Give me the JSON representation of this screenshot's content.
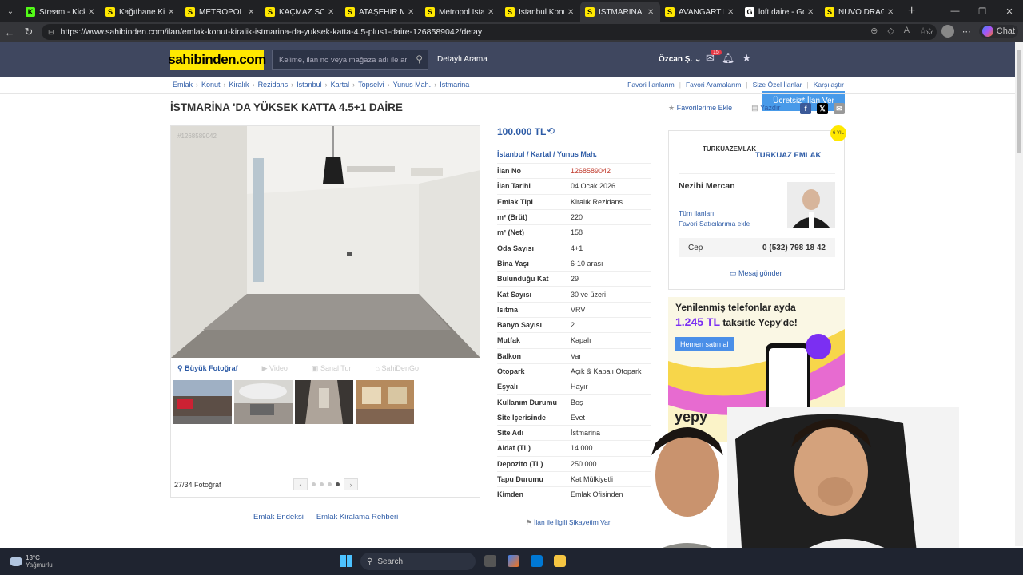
{
  "browser": {
    "tabs": [
      {
        "title": "Stream - Kick Das",
        "icon_color": "#53fc18",
        "icon_letter": "K",
        "active": false
      },
      {
        "title": "Kağıthane Kiralık",
        "icon_color": "#ffe800",
        "icon_letter": "S",
        "active": false
      },
      {
        "title": "METROPOL İSTAN",
        "icon_color": "#ffe800",
        "icon_letter": "S",
        "active": false
      },
      {
        "title": "KAÇMAZ SON FI",
        "icon_color": "#ffe800",
        "icon_letter": "S",
        "active": false
      },
      {
        "title": "ATAŞEHİR METRO",
        "icon_color": "#ffe800",
        "icon_letter": "S",
        "active": false
      },
      {
        "title": "Metropol İstanbu",
        "icon_color": "#ffe800",
        "icon_letter": "S",
        "active": false
      },
      {
        "title": "İstanbul Konut Fi",
        "icon_color": "#ffe800",
        "icon_letter": "S",
        "active": false
      },
      {
        "title": "İSTMARİNA 'DA Y",
        "icon_color": "#ffe800",
        "icon_letter": "S",
        "active": true
      },
      {
        "title": "AVANGART İSTAN",
        "icon_color": "#ffe800",
        "icon_letter": "S",
        "active": false
      },
      {
        "title": "loft daire - Googl",
        "icon_color": "#ffffff",
        "icon_letter": "G",
        "active": false
      },
      {
        "title": "NUVO DRAGOS S",
        "icon_color": "#ffe800",
        "icon_letter": "S",
        "active": false
      }
    ],
    "url": "https://www.sahibinden.com/ilan/emlak-konut-kiralik-istmarina-da-yuksek-katta-4.5-plus1-daire-1268589042/detay",
    "chat_label": "Chat"
  },
  "header": {
    "logo": "sahibinden.com",
    "search_placeholder": "Kelime, ilan no veya mağaza adı ile ara",
    "detailed_search": "Detaylı Arama",
    "user": "Özcan Ş.",
    "message_count": "15",
    "post_button": "Ücretsiz* İlan Ver"
  },
  "breadcrumb": [
    "Emlak",
    "Konut",
    "Kiralık",
    "Rezidans",
    "İstanbul",
    "Kartal",
    "Topselvi",
    "Yunus Mah.",
    "İstmarina"
  ],
  "quicklinks": [
    "Favori İlanlarım",
    "Favori Aramalarım",
    "Size Özel İlanlar",
    "Karşılaştır"
  ],
  "listing": {
    "title": "İSTMARİNA 'DA YÜKSEK KATTA 4.5+1 DAİRE",
    "add_favorite": "Favorilerime Ekle",
    "print": "Yazdır",
    "price": "100.000 TL",
    "location": [
      "İstanbul",
      "Kartal",
      "Yunus Mah."
    ],
    "photo_id": "#1268589042",
    "attributes": [
      {
        "k": "İlan No",
        "v": "1268589042",
        "red": true
      },
      {
        "k": "İlan Tarihi",
        "v": "04 Ocak 2026"
      },
      {
        "k": "Emlak Tipi",
        "v": "Kiralık Rezidans"
      },
      {
        "k": "m² (Brüt)",
        "v": "220"
      },
      {
        "k": "m² (Net)",
        "v": "158"
      },
      {
        "k": "Oda Sayısı",
        "v": "4+1"
      },
      {
        "k": "Bina Yaşı",
        "v": "6-10 arası"
      },
      {
        "k": "Bulunduğu Kat",
        "v": "29"
      },
      {
        "k": "Kat Sayısı",
        "v": "30 ve üzeri"
      },
      {
        "k": "Isıtma",
        "v": "VRV"
      },
      {
        "k": "Banyo Sayısı",
        "v": "2"
      },
      {
        "k": "Mutfak",
        "v": "Kapalı"
      },
      {
        "k": "Balkon",
        "v": "Var"
      },
      {
        "k": "Otopark",
        "v": "Açık & Kapalı Otopark"
      },
      {
        "k": "Eşyalı",
        "v": "Hayır"
      },
      {
        "k": "Kullanım Durumu",
        "v": "Boş"
      },
      {
        "k": "Site İçerisinde",
        "v": "Evet"
      },
      {
        "k": "Site Adı",
        "v": "İstmarina"
      },
      {
        "k": "Aidat (TL)",
        "v": "14.000"
      },
      {
        "k": "Depozito (TL)",
        "v": "250.000"
      },
      {
        "k": "Tapu Durumu",
        "v": "Kat Mülkiyetli"
      },
      {
        "k": "Kimden",
        "v": "Emlak Ofisinden"
      }
    ]
  },
  "gallery": {
    "big_photo": "Büyük Fotoğraf",
    "video": "Video",
    "virtual_tour": "Sanal Tur",
    "owner_home": "SahiDenGo",
    "count": "27/34 Fotoğraf",
    "page_dots": 4,
    "active_dot": 3
  },
  "seller": {
    "agency_logo": "TURKUAZEMLAK",
    "agency": "TURKUAZ EMLAK",
    "agent": "Nezihi Mercan",
    "all_ads": "Tüm ilanları",
    "favorite_seller": "Favori Satıcılarıma ekle",
    "phone_label": "Cep",
    "phone": "0 (532) 798 18 42",
    "message": "Mesaj gönder",
    "years_badge": "6 YIL"
  },
  "ad": {
    "line1": "Yenilenmiş telefonlar ayda",
    "line2": "1.245 TL",
    "line2b": "taksitle Yepy'de!",
    "cta": "Hemen satın al",
    "brand": "yepy"
  },
  "footer": {
    "links": [
      "Emlak Endeksi",
      "Emlak Kiralama Rehberi"
    ],
    "complaint": "İlan ile İlgili Şikayetim Var"
  },
  "taskbar": {
    "temp": "13°C",
    "weather": "Yağmurlu",
    "search": "Search"
  }
}
